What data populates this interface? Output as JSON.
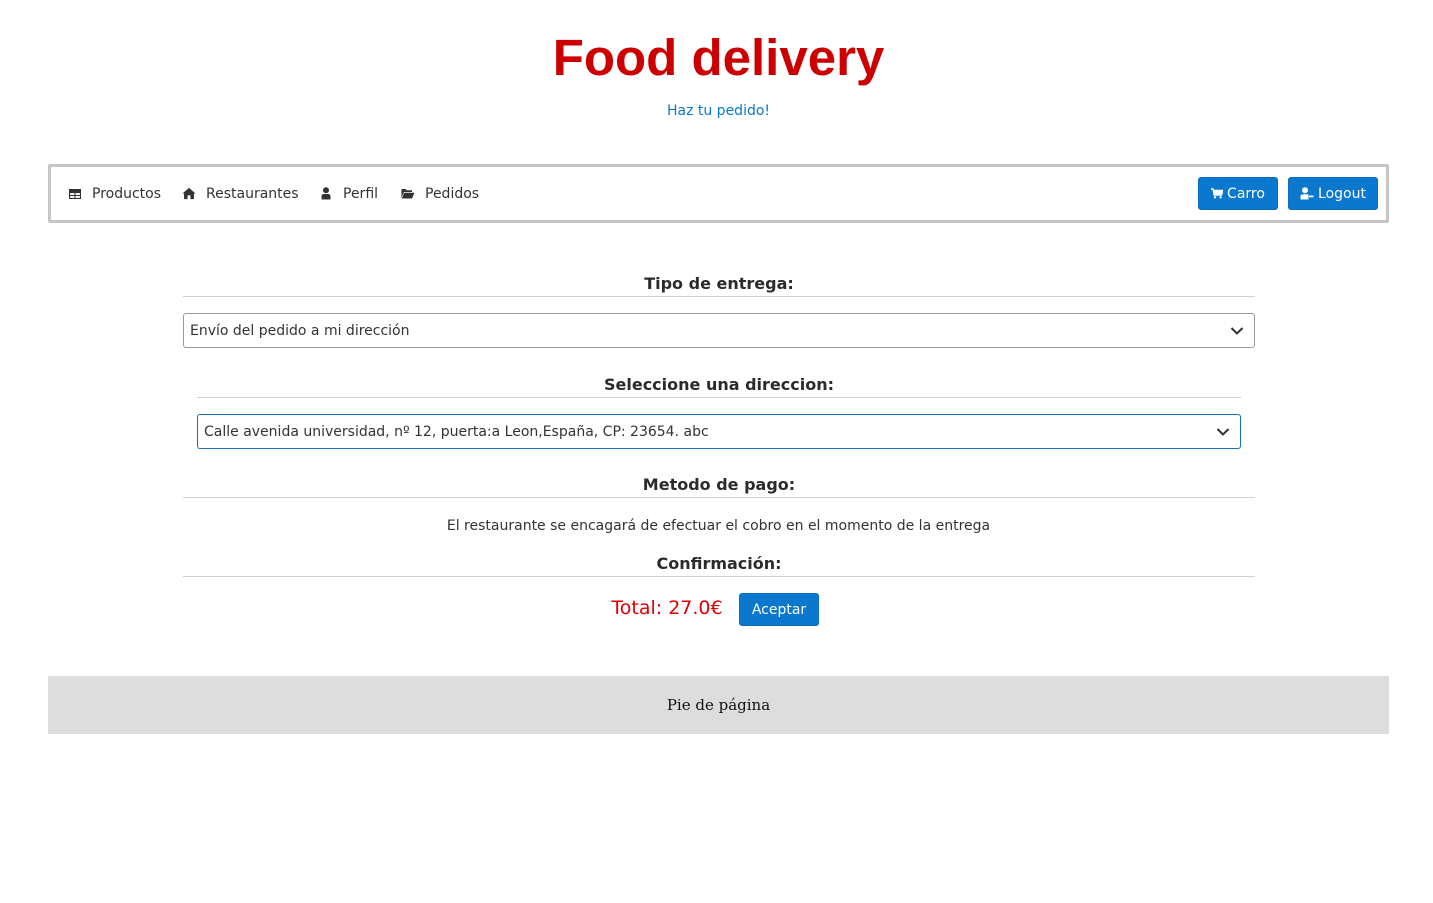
{
  "header": {
    "title": "Food delivery",
    "subtitle_link": "Haz tu pedido!"
  },
  "nav": {
    "items": [
      {
        "label": "Productos",
        "icon": "table-icon"
      },
      {
        "label": "Restaurantes",
        "icon": "home-icon"
      },
      {
        "label": "Perfil",
        "icon": "user-icon"
      },
      {
        "label": "Pedidos",
        "icon": "folder-open-icon"
      }
    ],
    "cart_label": "Carro",
    "logout_label": "Logout"
  },
  "delivery": {
    "heading": "Tipo de entrega:",
    "selected": "Envío del pedido a mi dirección"
  },
  "address": {
    "heading": "Seleccione una direccion:",
    "selected": "Calle avenida universidad, nº 12, puerta:a Leon,España, CP: 23654. abc"
  },
  "payment": {
    "heading": "Metodo de pago:",
    "text": "El restaurante se encagará de efectuar el cobro en el momento de la entrega"
  },
  "confirmation": {
    "heading": "Confirmación:",
    "total": "Total: 27.0€",
    "accept_label": "Aceptar"
  },
  "footer": {
    "text": "Pie de página"
  },
  "colors": {
    "title": "#cc0000",
    "primary": "#0a78cf",
    "total": "#e00000",
    "footer_bg": "#dddddd"
  }
}
